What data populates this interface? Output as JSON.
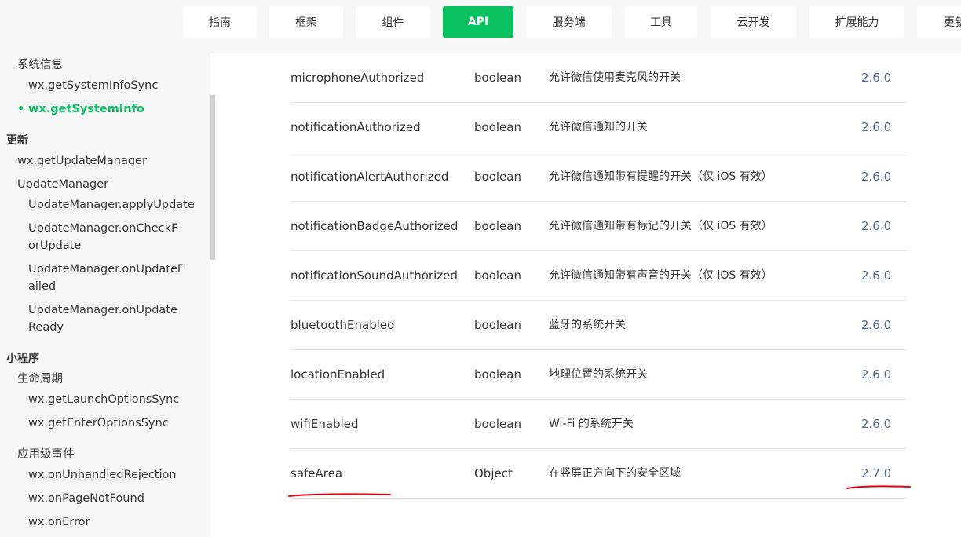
{
  "nav": {
    "items": [
      "指南",
      "框架",
      "组件",
      "API",
      "服务端",
      "工具",
      "云开发",
      "扩展能力",
      "更新"
    ],
    "active": "API",
    "accent": "#07c160"
  },
  "sidebar": {
    "items": [
      {
        "label": "系统信息",
        "level": 1
      },
      {
        "label": "wx.getSystemInfoSync",
        "level": 2
      },
      {
        "label": "wx.getSystemInfo",
        "level": 2,
        "active": true
      },
      {
        "label": "更新",
        "level": 0
      },
      {
        "label": "wx.getUpdateManager",
        "level": 1
      },
      {
        "label": "UpdateManager",
        "level": 1
      },
      {
        "label": "UpdateManager.applyUpdate",
        "level": 2
      },
      {
        "label": "UpdateManager.onCheckForUpdate",
        "level": 2
      },
      {
        "label": "UpdateManager.onUpdateFailed",
        "level": 2
      },
      {
        "label": "UpdateManager.onUpdateReady",
        "level": 2
      },
      {
        "label": "小程序",
        "level": 0
      },
      {
        "label": "生命周期",
        "level": 1
      },
      {
        "label": "wx.getLaunchOptionsSync",
        "level": 2
      },
      {
        "label": "wx.getEnterOptionsSync",
        "level": 2
      },
      {
        "label": "应用级事件",
        "level": 1
      },
      {
        "label": "wx.onUnhandledRejection",
        "level": 2
      },
      {
        "label": "wx.onPageNotFound",
        "level": 2
      },
      {
        "label": "wx.onError",
        "level": 2
      }
    ]
  },
  "table": {
    "rows": [
      {
        "name": "microphoneAuthorized",
        "type": "boolean",
        "desc": "允许微信使用麦克风的开关",
        "version": "2.6.0"
      },
      {
        "name": "notificationAuthorized",
        "type": "boolean",
        "desc": "允许微信通知的开关",
        "version": "2.6.0"
      },
      {
        "name": "notificationAlertAuthorized",
        "type": "boolean",
        "desc": "允许微信通知带有提醒的开关（仅 iOS 有效）",
        "version": "2.6.0"
      },
      {
        "name": "notificationBadgeAuthorized",
        "type": "boolean",
        "desc": "允许微信通知带有标记的开关（仅 iOS 有效）",
        "version": "2.6.0"
      },
      {
        "name": "notificationSoundAuthorized",
        "type": "boolean",
        "desc": "允许微信通知带有声音的开关（仅 iOS 有效）",
        "version": "2.6.0"
      },
      {
        "name": "bluetoothEnabled",
        "type": "boolean",
        "desc": "蓝牙的系统开关",
        "version": "2.6.0"
      },
      {
        "name": "locationEnabled",
        "type": "boolean",
        "desc": "地理位置的系统开关",
        "version": "2.6.0"
      },
      {
        "name": "wifiEnabled",
        "type": "boolean",
        "desc": "Wi-Fi 的系统开关",
        "version": "2.6.0"
      },
      {
        "name": "safeArea",
        "type": "Object",
        "desc": "在竖屏正方向下的安全区域",
        "version": "2.7.0"
      }
    ],
    "version_color": "#576b95",
    "annotation_color": "#e60012"
  }
}
